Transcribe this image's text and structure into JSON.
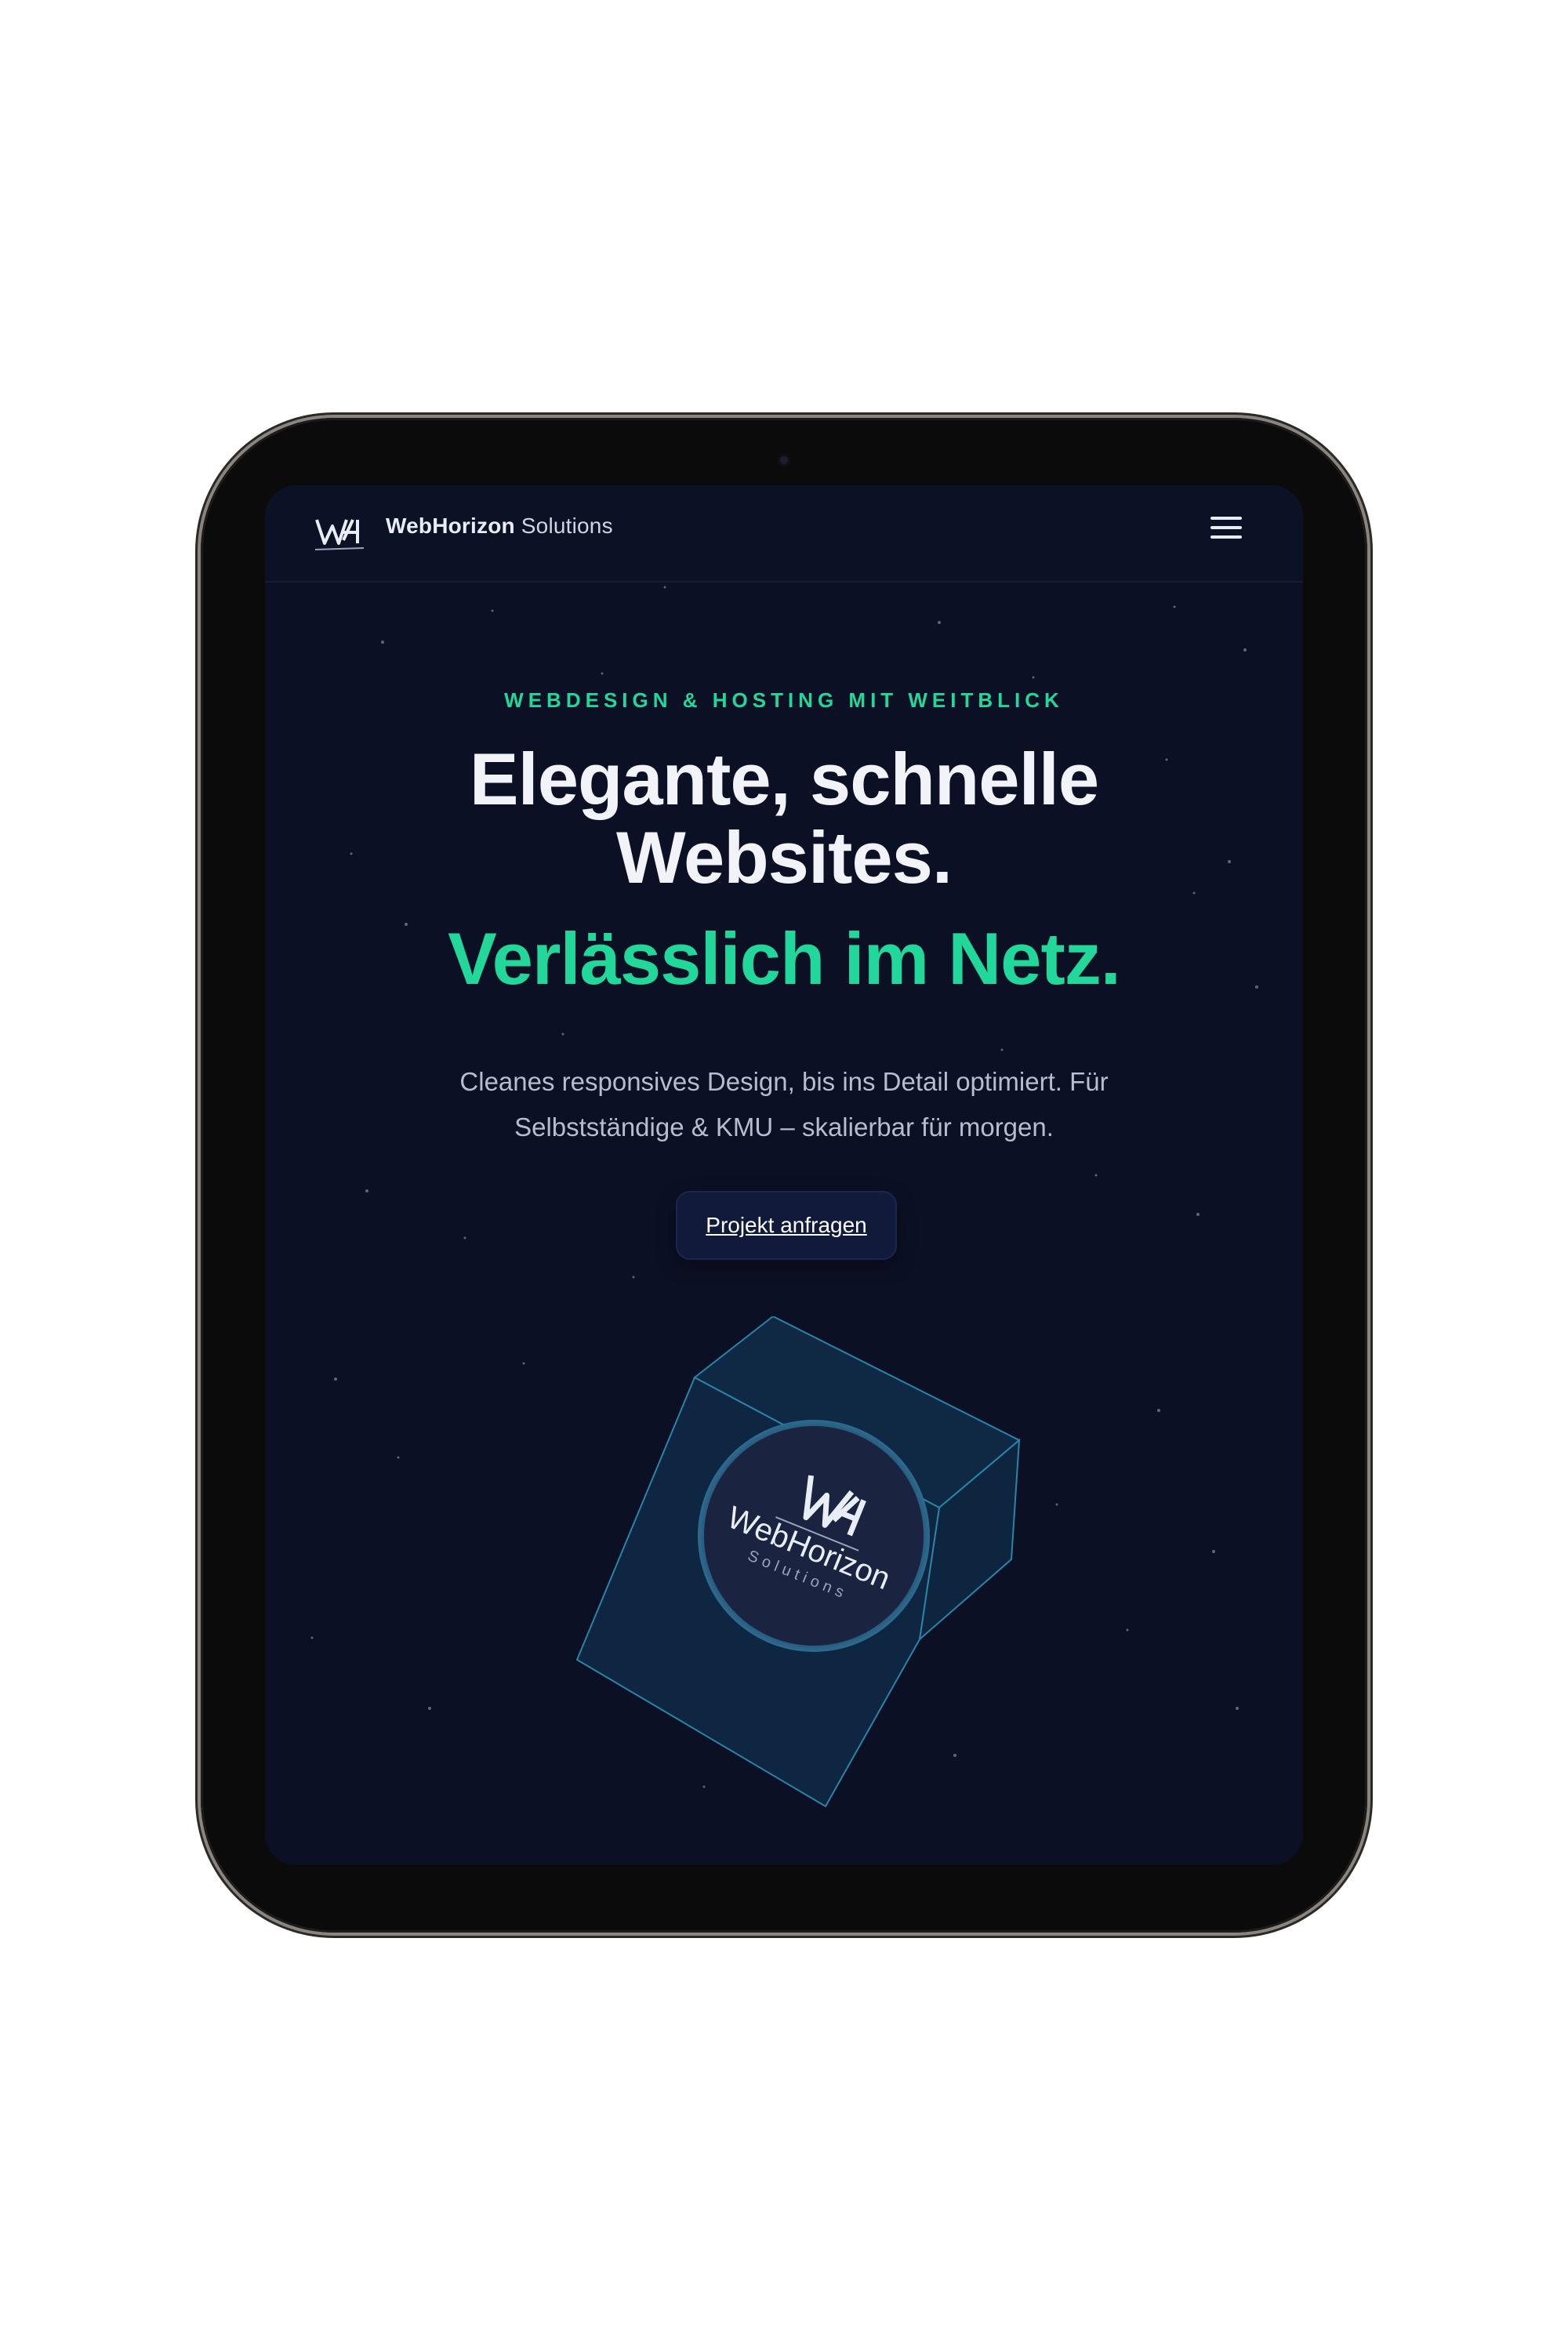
{
  "nav": {
    "brand_bold": "WebHorizon",
    "brand_light": "Solutions",
    "logo_icon": "wh-logo-icon",
    "menu_icon": "hamburger-menu-icon"
  },
  "hero": {
    "eyebrow": "WEBDESIGN & HOSTING MIT WEITBLICK",
    "headline_line1": "Elegante, schnelle",
    "headline_line2": "Websites.",
    "headline_accent": "Verlässlich im Netz.",
    "subtitle_line1": "Cleanes responsives Design, bis ins Detail optimiert. Für",
    "subtitle_line2": "Selbstständige & KMU – skalierbar für morgen.",
    "cta_label": "Projekt anfragen"
  },
  "cube": {
    "logo_text": "WebHorizon",
    "logo_subtext": "Solutions"
  },
  "colors": {
    "background": "#0b1024",
    "accent": "#22d79a",
    "text": "#f1f3f8",
    "muted": "#b6bdcd",
    "device_frame": "#0b0b0c"
  }
}
